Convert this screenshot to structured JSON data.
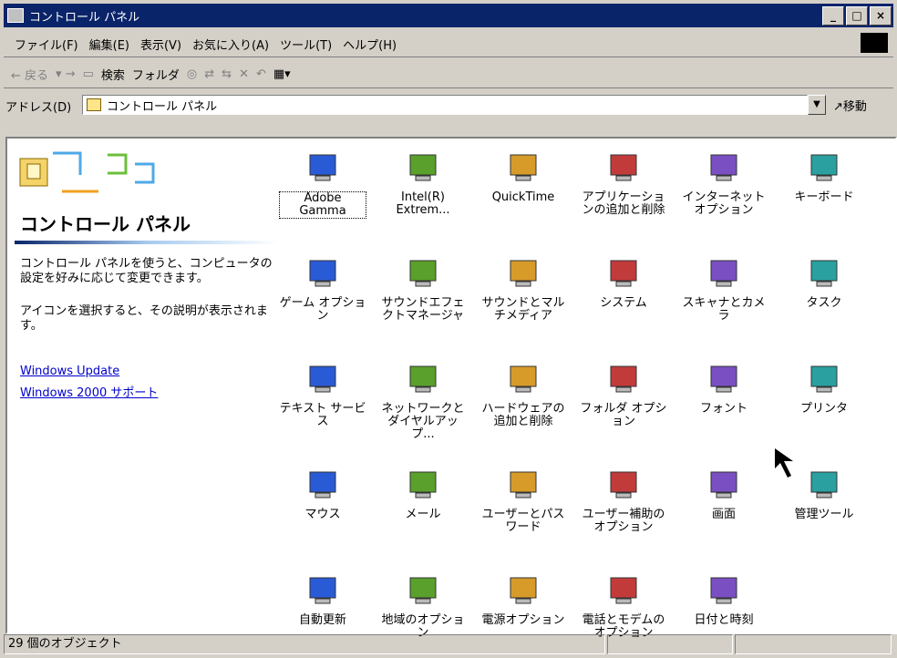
{
  "window": {
    "title": "コントロール パネル"
  },
  "menu": [
    "ファイル(F)",
    "編集(E)",
    "表示(V)",
    "お気に入り(A)",
    "ツール(T)",
    "ヘルプ(H)"
  ],
  "toolbar": {
    "back": "← 戻る",
    "search": "検索",
    "folders": "フォルダ"
  },
  "address": {
    "label": "アドレス(D)",
    "value": "コントロール パネル",
    "go": "移動"
  },
  "left_panel": {
    "title": "コントロール パネル",
    "desc1": "コントロール パネルを使うと、コンピュータの設定を好みに応じて変更できます。",
    "desc2": "アイコンを選択すると、その説明が表示されます。",
    "links": [
      "Windows Update",
      "Windows 2000 サポート"
    ]
  },
  "icons": [
    {
      "label": "Adobe Gamma",
      "icon": "monitor-icon"
    },
    {
      "label": "Intel(R) Extrem...",
      "icon": "display-icon"
    },
    {
      "label": "QuickTime",
      "icon": "quicktime-icon"
    },
    {
      "label": "アプリケーションの追加と削除",
      "icon": "add-remove-icon"
    },
    {
      "label": "インターネット オプション",
      "icon": "globe-monitor-icon"
    },
    {
      "label": "キーボード",
      "icon": "keyboard-icon"
    },
    {
      "label": "ゲーム オプション",
      "icon": "joystick-icon"
    },
    {
      "label": "サウンドエフェクトマネージャ",
      "icon": "sound-effect-icon"
    },
    {
      "label": "サウンドとマルチメディア",
      "icon": "speaker-icon"
    },
    {
      "label": "システム",
      "icon": "computer-icon"
    },
    {
      "label": "スキャナとカメラ",
      "icon": "scanner-icon"
    },
    {
      "label": "タスク",
      "icon": "task-folder-icon"
    },
    {
      "label": "テキスト サービス",
      "icon": "text-service-icon"
    },
    {
      "label": "ネットワークとダイヤルアップ...",
      "icon": "network-icon"
    },
    {
      "label": "ハードウェアの追加と削除",
      "icon": "hardware-icon"
    },
    {
      "label": "フォルダ オプション",
      "icon": "folder-options-icon"
    },
    {
      "label": "フォント",
      "icon": "font-icon"
    },
    {
      "label": "プリンタ",
      "icon": "printer-icon"
    },
    {
      "label": "マウス",
      "icon": "mouse-icon"
    },
    {
      "label": "メール",
      "icon": "mail-icon"
    },
    {
      "label": "ユーザーとパスワード",
      "icon": "users-icon"
    },
    {
      "label": "ユーザー補助のオプション",
      "icon": "accessibility-icon"
    },
    {
      "label": "画面",
      "icon": "screen-icon"
    },
    {
      "label": "管理ツール",
      "icon": "admin-tools-icon"
    },
    {
      "label": "自動更新",
      "icon": "windows-update-icon"
    },
    {
      "label": "地域のオプション",
      "icon": "globe-icon"
    },
    {
      "label": "電源オプション",
      "icon": "power-icon"
    },
    {
      "label": "電話とモデムのオプション",
      "icon": "phone-icon"
    },
    {
      "label": "日付と時刻",
      "icon": "calendar-clock-icon"
    }
  ],
  "status": {
    "count": "29 個のオブジェクト"
  }
}
